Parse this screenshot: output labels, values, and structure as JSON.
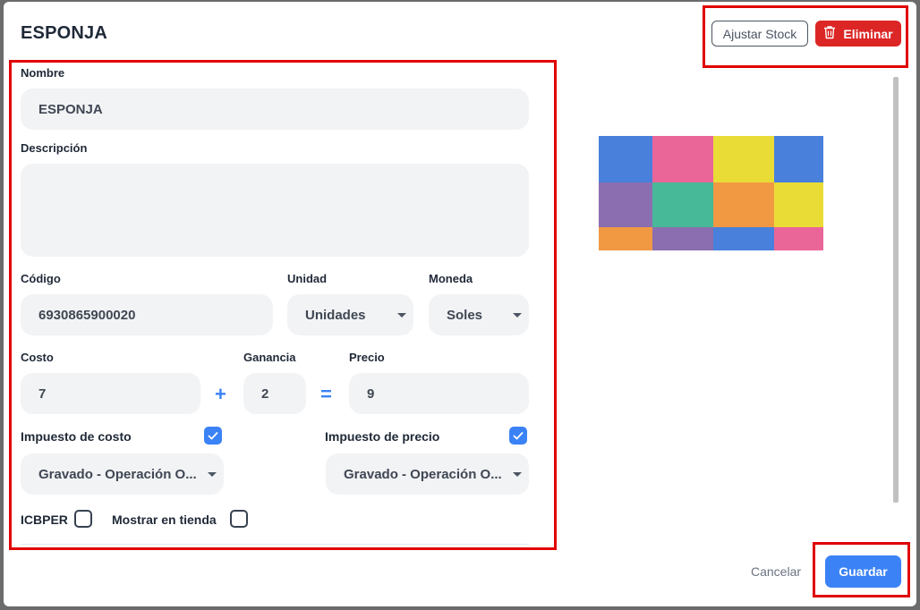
{
  "header": {
    "title": "ESPONJA",
    "adjust_stock_label": "Ajustar Stock",
    "delete_label": "Eliminar"
  },
  "form": {
    "name_label": "Nombre",
    "name_value": "ESPONJA",
    "description_label": "Descripción",
    "description_value": "",
    "code_label": "Código",
    "code_value": "6930865900020",
    "unit_label": "Unidad",
    "unit_value": "Unidades",
    "currency_label": "Moneda",
    "currency_value": "Soles",
    "cost_label": "Costo",
    "cost_value": "7",
    "profit_label": "Ganancia",
    "profit_value": "2",
    "price_label": "Precio",
    "price_value": "9",
    "plus_symbol": "+",
    "equals_symbol": "=",
    "cost_tax_label": "Impuesto de costo",
    "cost_tax_checked": true,
    "cost_tax_value": "Gravado - Operación O...",
    "price_tax_label": "Impuesto de precio",
    "price_tax_checked": true,
    "price_tax_value": "Gravado - Operación O...",
    "icbper_label": "ICBPER",
    "icbper_checked": false,
    "show_in_store_label": "Mostrar en tienda",
    "show_in_store_checked": false
  },
  "image": {
    "icon": "product-photo-sponge-blocks",
    "colors": [
      "#2f6fd6",
      "#e8508a",
      "#e8d81c",
      "#7b5aa6",
      "#2fb08a",
      "#f08a2a"
    ]
  },
  "footer": {
    "cancel_label": "Cancelar",
    "save_label": "Guardar"
  },
  "colors": {
    "primary": "#3b82f6",
    "danger": "#dc2626",
    "highlight": "#e00000",
    "field_bg": "#f2f3f5"
  }
}
